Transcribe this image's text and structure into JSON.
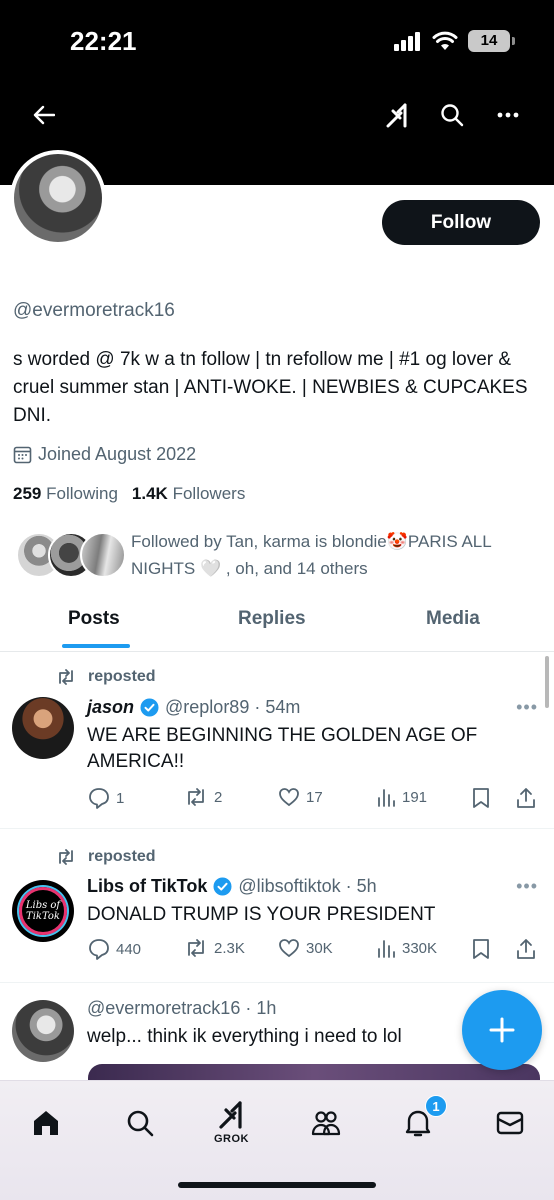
{
  "status_bar": {
    "time": "22:21",
    "battery": "14"
  },
  "header": {
    "icons": [
      "back-arrow-icon",
      "grok-icon",
      "search-icon",
      "more-icon"
    ]
  },
  "profile": {
    "follow_label": "Follow",
    "handle": "@evermoretrack16",
    "bio": "s worded @ 7k w a tn follow | tn refollow me | #1 og lover & cruel summer stan | ANTI-WOKE. | NEWBIES & CUPCAKES DNI.",
    "joined": "Joined August 2022",
    "following_count": "259",
    "following_label": "Following",
    "followers_count": "1.4K",
    "followers_label": "Followers",
    "followed_by": "Followed by Tan, karma is blondie🤡PARIS ALL NIGHTS 🤍 , oh, and 14 others"
  },
  "tabs": [
    {
      "label": "Posts",
      "active": true
    },
    {
      "label": "Replies",
      "active": false
    },
    {
      "label": "Media",
      "active": false
    }
  ],
  "posts": [
    {
      "repost_label": "reposted",
      "name": "jason",
      "verified": true,
      "handle_time": "@replor89 · 54m",
      "text": "WE ARE BEGINNING THE GOLDEN AGE OF AMERICA!!",
      "replies": "1",
      "reposts": "2",
      "likes": "17",
      "views": "191"
    },
    {
      "repost_label": "reposted",
      "name": "Libs of TikTok",
      "verified": true,
      "avatar_text": "Libs of TikTok",
      "handle_time": "@libsoftiktok · 5h",
      "text": "DONALD TRUMP IS YOUR PRESIDENT",
      "replies": "440",
      "reposts": "2.3K",
      "likes": "30K",
      "views": "330K"
    },
    {
      "handle_time": "@evermoretrack16 · 1h",
      "text": "welp... think ik everything i need to lol"
    }
  ],
  "bottom_nav": {
    "grok_label": "GROK",
    "notifications_badge": "1"
  },
  "colors": {
    "accent": "#1d9bf0",
    "text": "#0f1419",
    "secondary": "#536471"
  }
}
